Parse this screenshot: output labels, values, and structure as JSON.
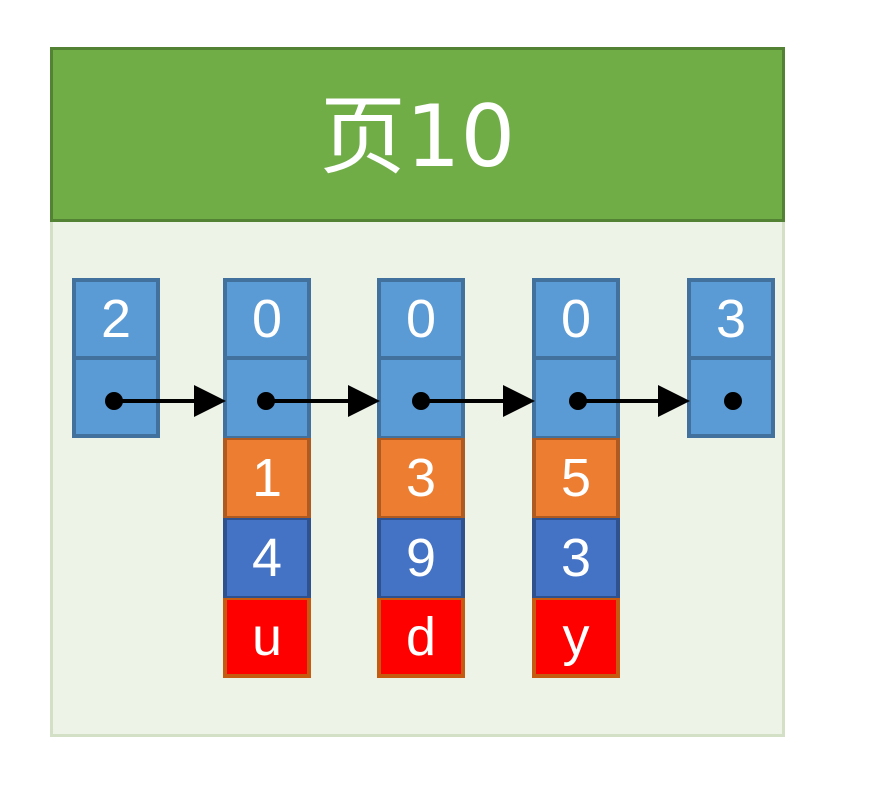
{
  "page": {
    "title": "页10"
  },
  "records": [
    {
      "id": "infimum",
      "header": "2",
      "order": "",
      "key": "",
      "value": ""
    },
    {
      "id": "record-1",
      "header": "0",
      "order": "1",
      "key": "4",
      "value": "u"
    },
    {
      "id": "record-2",
      "header": "0",
      "order": "3",
      "key": "9",
      "value": "d"
    },
    {
      "id": "record-3",
      "header": "0",
      "order": "5",
      "key": "3",
      "value": "y"
    },
    {
      "id": "supremum",
      "header": "3",
      "order": "",
      "key": "",
      "value": ""
    }
  ],
  "colors": {
    "header_green": "#70ad47",
    "header_blue": "#5b9bd5",
    "order_orange": "#ed7d31",
    "key_blue": "#4472c4",
    "value_red": "#ff0000",
    "page_bg": "#eef3e8"
  }
}
